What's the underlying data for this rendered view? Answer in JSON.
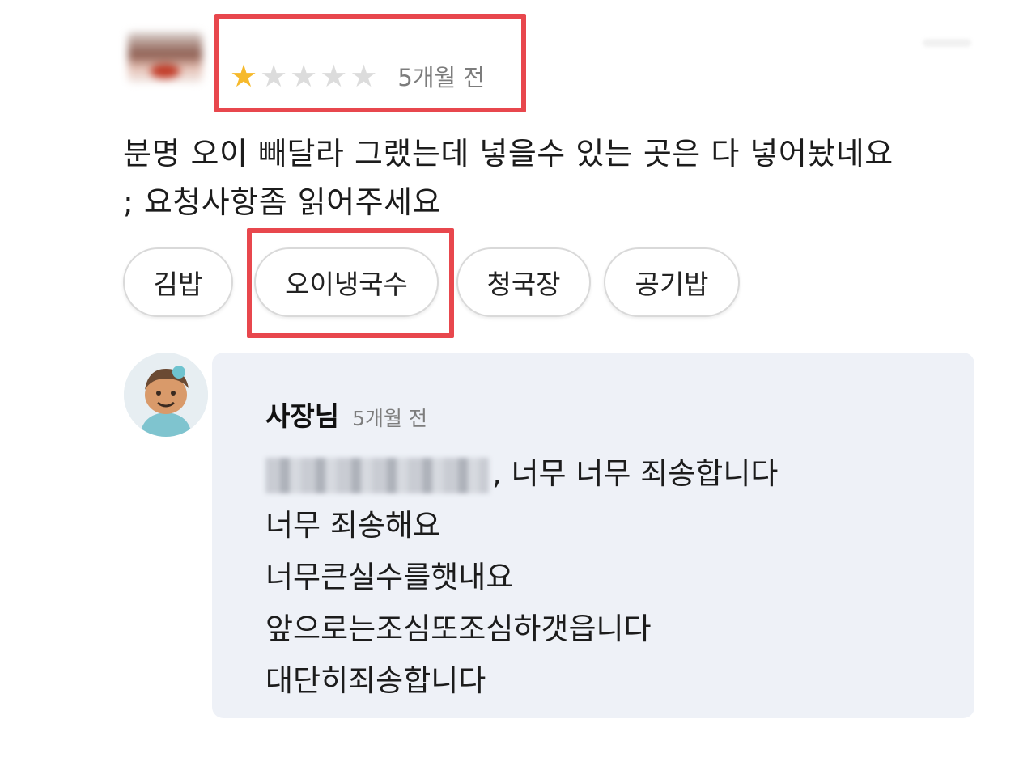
{
  "review": {
    "rating": 1,
    "rating_max": 5,
    "time": "5개월 전",
    "text_lines": [
      "분명 오이 빼달라 그랬는데 넣을수 있는 곳은 다 넣어놨네요",
      "; 요청사항좀 읽어주세요"
    ],
    "tags": [
      "김밥",
      "오이냉국수",
      "청국장",
      "공기밥"
    ]
  },
  "reply": {
    "author": "사장님",
    "time": "5개월 전",
    "line1_suffix": ", 너무 너무 죄송합니다",
    "lines": [
      "너무 죄송해요",
      "너무큰실수를햇내요",
      "앞으로는조심또조심하갯읍니다",
      "대단히죄송합니다"
    ]
  },
  "colors": {
    "highlight": "#e8474d",
    "star_filled": "#f6b92b",
    "star_empty": "#dcdcdc",
    "reply_background": "#eef1f7"
  }
}
